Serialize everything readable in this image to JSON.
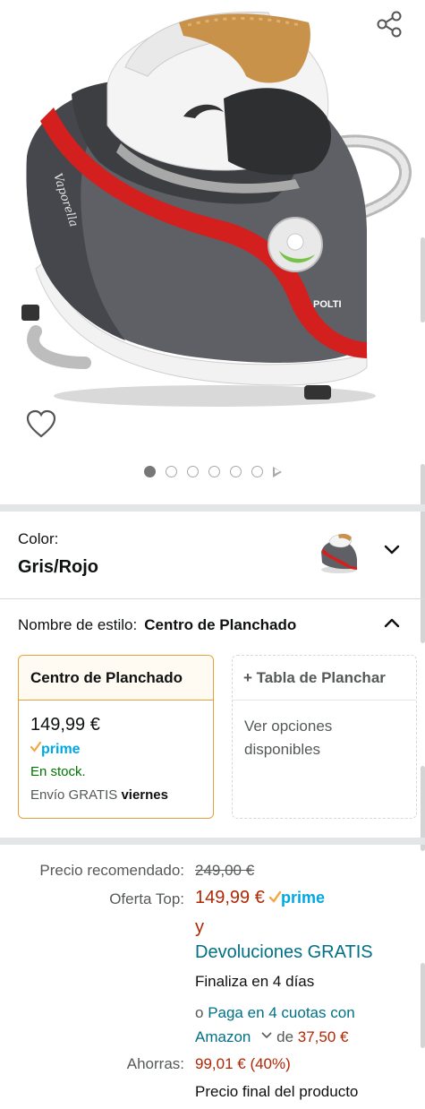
{
  "gallery": {
    "image_alt": "Polti Vaporella steam generator iron, grey and red",
    "product_logo_text": "POLTI",
    "product_model_text": "Vaporella",
    "dot_count": 6,
    "active_dot": 0
  },
  "variation": {
    "color_label": "Color:",
    "color_value": "Gris/Rojo",
    "style_label": "Nombre de estilo:",
    "style_value": "Centro de Planchado"
  },
  "options": [
    {
      "name": "Centro de Planchado",
      "price": "149,99 €",
      "prime": "prime",
      "stock": "En stock.",
      "shipping_prefix": "Envío GRATIS",
      "shipping_day": "viernes",
      "selected": true
    },
    {
      "name": "+ Tabla de Planchar",
      "note": "Ver opciones disponibles",
      "selected": false
    }
  ],
  "pricing": {
    "list_label": "Precio recomendado:",
    "list_price": "249,00 €",
    "deal_label": "Oferta Top:",
    "deal_price": "149,99 €",
    "prime": "prime",
    "conj": "y",
    "returns": "Devoluciones GRATIS",
    "ends": "Finaliza en 4 días",
    "inst_prefix": "o ",
    "inst_link": "Paga en 4 cuotas con Amazon",
    "inst_de": "de ",
    "inst_amount": "37,50 €",
    "savings_label": "Ahorras:",
    "savings_value": "99,01 € (40%)",
    "final_note": "Precio final del producto"
  },
  "colors": {
    "price_red": "#B12704",
    "link_teal": "#007185",
    "stock_green": "#007600",
    "prime_blue": "#00A8E1",
    "selected_border": "#E3A23A"
  }
}
